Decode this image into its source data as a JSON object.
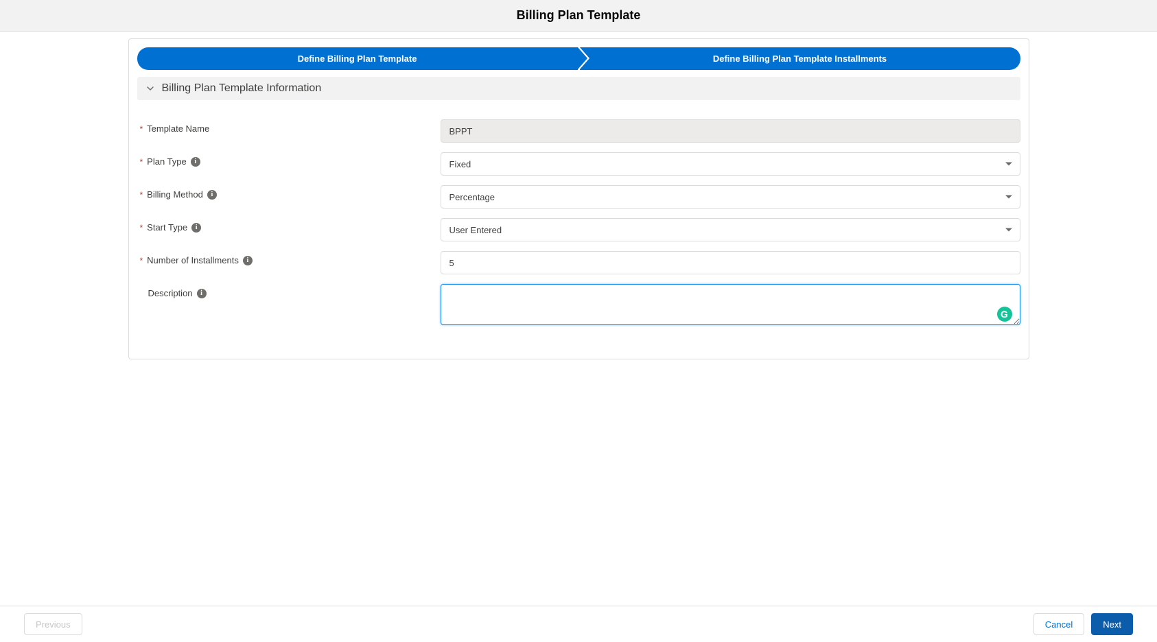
{
  "header": {
    "title": "Billing Plan Template"
  },
  "progress": {
    "step1": "Define Billing Plan Template",
    "step2": "Define Billing Plan Template Installments"
  },
  "section": {
    "title": "Billing Plan Template Information"
  },
  "fields": {
    "templateName": {
      "label": "Template Name",
      "value": "BPPT",
      "required": true
    },
    "planType": {
      "label": "Plan Type",
      "value": "Fixed",
      "required": true
    },
    "billingMethod": {
      "label": "Billing Method",
      "value": "Percentage",
      "required": true
    },
    "startType": {
      "label": "Start Type",
      "value": "User Entered",
      "required": true
    },
    "numberOfInstallments": {
      "label": "Number of Installments",
      "value": "5",
      "required": true
    },
    "description": {
      "label": "Description",
      "value": "",
      "required": false
    }
  },
  "footer": {
    "previous": "Previous",
    "cancel": "Cancel",
    "next": "Next"
  },
  "requiredMarker": "*"
}
